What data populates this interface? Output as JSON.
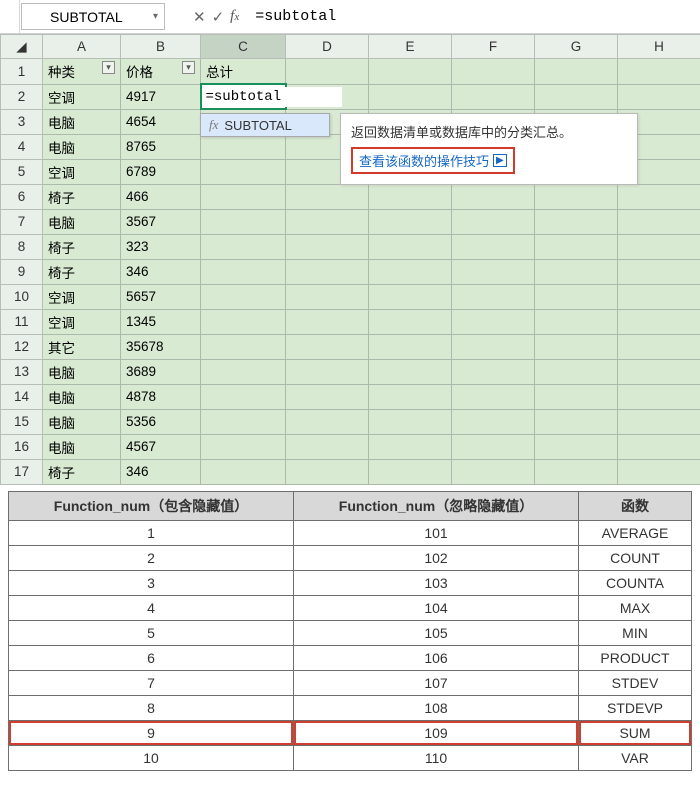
{
  "formula_bar": {
    "namebox": "SUBTOTAL",
    "formula": "=subtotal"
  },
  "grid": {
    "cols": [
      "A",
      "B",
      "C",
      "D",
      "E",
      "F",
      "G",
      "H"
    ],
    "headers": {
      "A": "种类",
      "B": "价格",
      "C": "总计"
    },
    "active_cell_value": "=subtotal",
    "rows": [
      {
        "n": 1
      },
      {
        "n": 2,
        "A": "空调",
        "B": "4917"
      },
      {
        "n": 3,
        "A": "电脑",
        "B": "4654"
      },
      {
        "n": 4,
        "A": "电脑",
        "B": "8765"
      },
      {
        "n": 5,
        "A": "空调",
        "B": "6789"
      },
      {
        "n": 6,
        "A": "椅子",
        "B": "466"
      },
      {
        "n": 7,
        "A": "电脑",
        "B": "3567"
      },
      {
        "n": 8,
        "A": "椅子",
        "B": "323"
      },
      {
        "n": 9,
        "A": "椅子",
        "B": "346"
      },
      {
        "n": 10,
        "A": "空调",
        "B": "5657"
      },
      {
        "n": 11,
        "A": "空调",
        "B": "1345"
      },
      {
        "n": 12,
        "A": "其它",
        "B": "35678"
      },
      {
        "n": 13,
        "A": "电脑",
        "B": "3689"
      },
      {
        "n": 14,
        "A": "电脑",
        "B": "4878"
      },
      {
        "n": 15,
        "A": "电脑",
        "B": "5356"
      },
      {
        "n": 16,
        "A": "电脑",
        "B": "4567"
      },
      {
        "n": 17,
        "A": "椅子",
        "B": "346"
      }
    ]
  },
  "autocomplete": {
    "item": "SUBTOTAL"
  },
  "tooltip": {
    "desc": "返回数据清单或数据库中的分类汇总。",
    "link": "查看该函数的操作技巧",
    "icon": "▶"
  },
  "ref_table": {
    "headers": [
      "Function_num（包含隐藏值）",
      "Function_num（忽略隐藏值）",
      "函数"
    ],
    "rows": [
      {
        "a": "1",
        "b": "101",
        "c": "AVERAGE"
      },
      {
        "a": "2",
        "b": "102",
        "c": "COUNT"
      },
      {
        "a": "3",
        "b": "103",
        "c": "COUNTA"
      },
      {
        "a": "4",
        "b": "104",
        "c": "MAX"
      },
      {
        "a": "5",
        "b": "105",
        "c": "MIN"
      },
      {
        "a": "6",
        "b": "106",
        "c": "PRODUCT"
      },
      {
        "a": "7",
        "b": "107",
        "c": "STDEV"
      },
      {
        "a": "8",
        "b": "108",
        "c": "STDEVP"
      },
      {
        "a": "9",
        "b": "109",
        "c": "SUM",
        "hl": true
      },
      {
        "a": "10",
        "b": "110",
        "c": "VAR"
      }
    ]
  }
}
